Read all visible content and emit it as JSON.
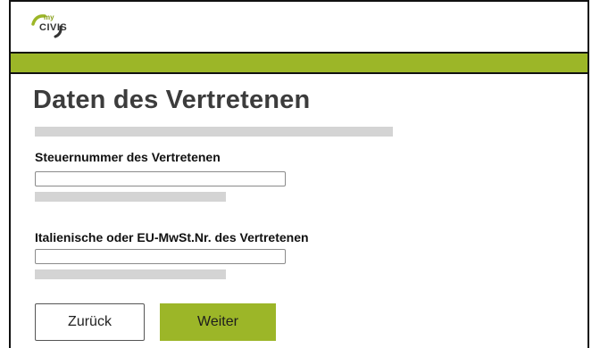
{
  "header": {
    "logo": {
      "my": "my",
      "civis": "CIVIS"
    },
    "bar_color": "#9cb628"
  },
  "page": {
    "title": "Daten des Vertretenen"
  },
  "form": {
    "fields": [
      {
        "label": "Steuernummer des Vertretenen",
        "value": "",
        "placeholder": ""
      },
      {
        "label": "Italienische oder EU-MwSt.Nr. des Vertretenen",
        "value": "",
        "placeholder": ""
      }
    ]
  },
  "actions": {
    "back_label": "Zurück",
    "next_label": "Weiter"
  },
  "colors": {
    "accent": "#9cb628",
    "placeholder_bar": "#d4d4d4",
    "border": "#111111"
  }
}
